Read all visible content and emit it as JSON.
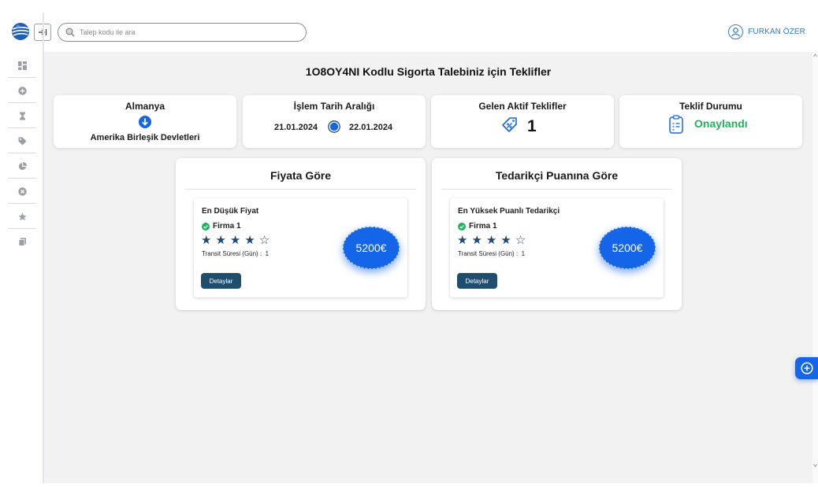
{
  "header": {
    "search_placeholder": "Talep kodu ile ara",
    "user_name": "FURKAN ÖZER"
  },
  "sidebar": {
    "items": [
      "dashboard-icon",
      "plus-circle-icon",
      "hourglass-icon",
      "tag-icon",
      "pie-chart-icon",
      "close-circle-icon",
      "star-icon",
      "copy-icon"
    ]
  },
  "page": {
    "title": "1O8OY4NI Kodlu Sigorta Talebiniz için Teklifler"
  },
  "cards": {
    "route": {
      "from": "Almanya",
      "to": "Amerika Birleşik Devletleri"
    },
    "date_range": {
      "title": "İşlem Tarih Aralığı",
      "start": "21.01.2024",
      "end": "22.01.2024"
    },
    "active_offers": {
      "title": "Gelen Aktif Teklifler",
      "count": "1"
    },
    "status": {
      "title": "Teklif Durumu",
      "value": "Onaylandı"
    }
  },
  "results": [
    {
      "title": "Fiyata Göre",
      "label": "En Düşük Fiyat",
      "firm": "Firma 1",
      "rating": 4,
      "rating_max": 5,
      "transit_label": "Transit Süresi (Gün) :",
      "transit_value": "1",
      "button": "Detaylar",
      "price": "5200€"
    },
    {
      "title": "Tedarikçi Puanına Göre",
      "label": "En Yüksek Puanlı Tedarikçi",
      "firm": "Firma 1",
      "rating": 4,
      "rating_max": 5,
      "transit_label": "Transit Süresi (Gün) :",
      "transit_value": "1",
      "button": "Detaylar",
      "price": "5200€"
    }
  ],
  "colors": {
    "accent": "#1565e8",
    "navy": "#1f4d6e",
    "success": "#1eb55a",
    "star": "#1b4a7a"
  }
}
